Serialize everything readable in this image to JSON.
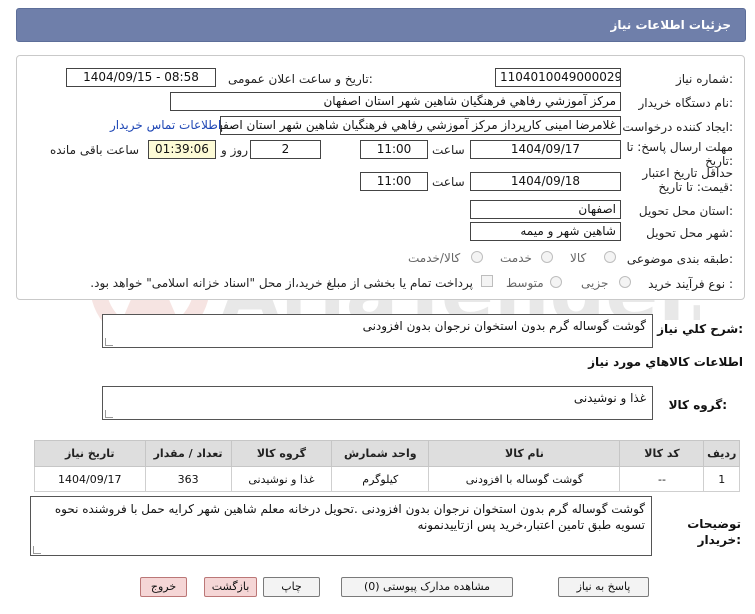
{
  "header": {
    "title": "جزئیات اطلاعات نیاز"
  },
  "form": {
    "need_number_label": "شماره نیاز:",
    "need_number": "1104010049000029",
    "announce_label": "تاریخ و ساعت اعلان عمومی:",
    "announce_value": "1404/09/15 - 08:58",
    "buyer_org_label": "نام دستگاه خریدار:",
    "buyer_org": "مرکز آموزشي رفاهي فرهنگيان شاهين شهر استان اصفهان",
    "creator_label": "ایجاد کننده درخواست:",
    "creator": "غلامرضا امینی کارپرداز مرکز آموزشي رفاهي فرهنگيان شاهين شهر استان اصفهان",
    "contact_link": "اطلاعات تماس خریدار",
    "deadline_label_1": "مهلت ارسال پاسخ: تا",
    "deadline_label_2": "تاریخ:",
    "deadline_date": "1404/09/17",
    "time_label": "ساعت",
    "deadline_time": "11:00",
    "days_value": "2",
    "days_label": "روز و",
    "remaining_value": "01:39:06",
    "remaining_label": "ساعت باقی مانده",
    "validity_label_1": "حداقل تاریخ اعتبار",
    "validity_label_2": "قیمت: تا تاریخ:",
    "validity_date": "1404/09/18",
    "validity_time": "11:00",
    "province_label": "استان محل تحویل:",
    "province": "اصفهان",
    "city_label": "شهر محل تحویل:",
    "city": "شاهین شهر و میمه",
    "category_label": "طبقه بندی موضوعی:",
    "category_options": [
      "کالا",
      "خدمت",
      "کالا/خدمت"
    ],
    "process_label": "نوع فرآیند خرید :",
    "process_options": [
      "جزیی",
      "متوسط"
    ],
    "payment_note": "پرداخت تمام یا بخشی از مبلغ خرید،از محل \"اسناد خزانه اسلامی\" خواهد بود."
  },
  "summary": {
    "label": "شرح كلي نياز:",
    "text": "گوشت گوساله گرم بدون استخوان نرجوان بدون افزودنی"
  },
  "goods": {
    "section_title": "اطلاعات كالاهاي مورد نياز",
    "group_label": "گروه کالا:",
    "group_value": "غذا و نوشیدنی"
  },
  "table": {
    "headers": [
      "ردیف",
      "کد کالا",
      "نام کالا",
      "واحد شمارش",
      "گروه کالا",
      "تعداد / مقدار",
      "تاریخ نیاز"
    ],
    "rows": [
      [
        "1",
        "--",
        "گوشت گوساله با افزودنی",
        "کیلوگرم",
        "غذا و نوشیدنی",
        "363",
        "1404/09/17"
      ]
    ]
  },
  "notes": {
    "label_1": "توضیحات",
    "label_2": "خریدار:",
    "text": "گوشت گوساله گرم بدون استخوان نرجوان بدون افزودنی .تحویل درخانه معلم شاهین شهر کرایه حمل با فروشنده نحوه تسویه طبق تامین اعتبار،خرید پس ازتاییدنمونه"
  },
  "buttons": {
    "reply": "پاسخ به نیاز",
    "docs": "مشاهده مدارک پیوستی (0)",
    "print": "چاپ",
    "back": "بازگشت",
    "exit": "خروج"
  },
  "watermark_text": "AriaTender.neT"
}
